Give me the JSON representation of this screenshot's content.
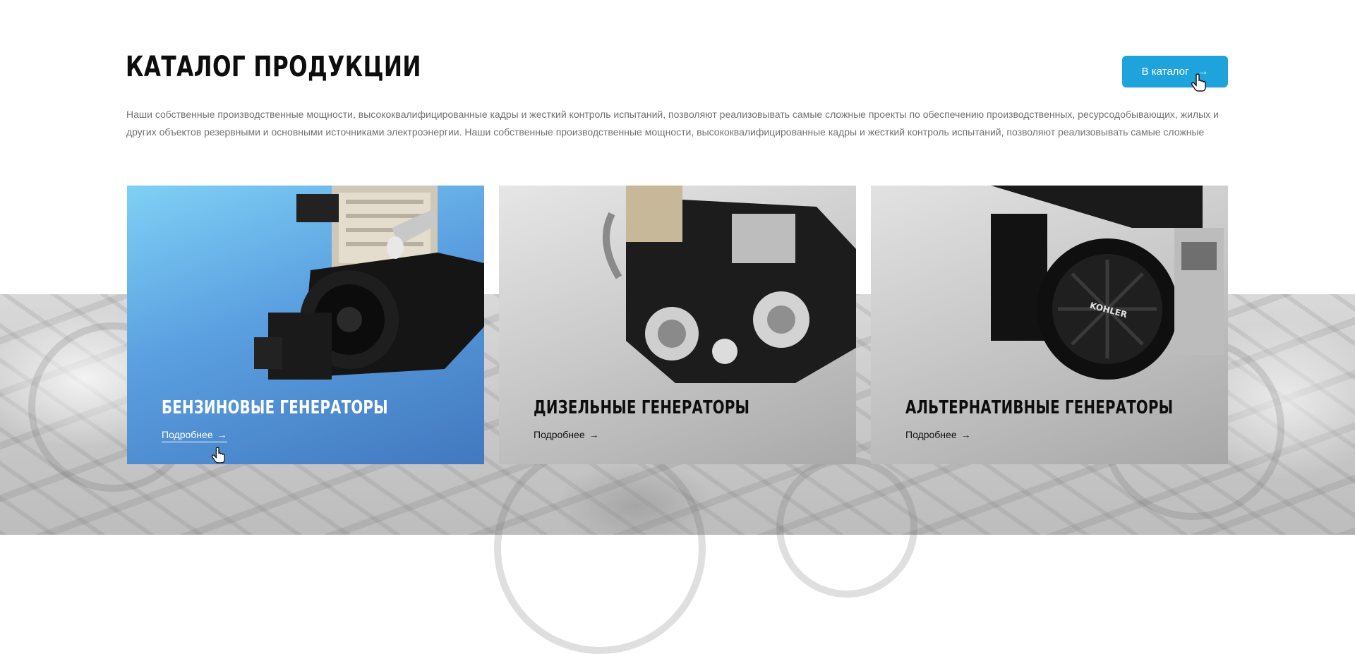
{
  "header": {
    "title": "КАТАЛОГ ПРОДУКЦИИ",
    "catalog_button": {
      "label": "В каталог",
      "icon": "arrow-right-icon",
      "color": "#1fa3dc"
    }
  },
  "description": "Наши собственные производственные мощности, высококвалифицированные кадры и жесткий контроль испытаний, позволяют реализовывать самые сложные проекты по обеспечению производственных, ресурсодобывающих, жилых и других объектов резервными и основными источниками электроэнергии. Наши собственные производственные мощности, высококвалифицированные кадры и жесткий контроль испытаний, позволяют реализовывать самые сложные",
  "cards": [
    {
      "title": "БЕНЗИНОВЫЕ ГЕНЕРАТОРЫ",
      "link_label": "Подробнее",
      "link_icon": "arrow-right-icon",
      "image_icon": "engine-image",
      "active": true,
      "gradient_colors": [
        "#7fd0f5",
        "#4278bf"
      ]
    },
    {
      "title": "ДИЗЕЛЬНЫЕ ГЕНЕРАТОРЫ",
      "link_label": "Подробнее",
      "link_icon": "arrow-right-icon",
      "image_icon": "engine-image",
      "active": false,
      "gradient_colors": [
        "#e6e6e6",
        "#a9a9a9"
      ]
    },
    {
      "title": "АЛЬТЕРНАТИВНЫЕ ГЕНЕРАТОРЫ",
      "link_label": "Подробнее",
      "link_icon": "arrow-right-icon",
      "image_icon": "engine-image",
      "brand_mark": "KOHLER",
      "active": false,
      "gradient_colors": [
        "#e2e2e2",
        "#a7a7a7"
      ]
    }
  ],
  "icons": {
    "arrow": "→"
  }
}
